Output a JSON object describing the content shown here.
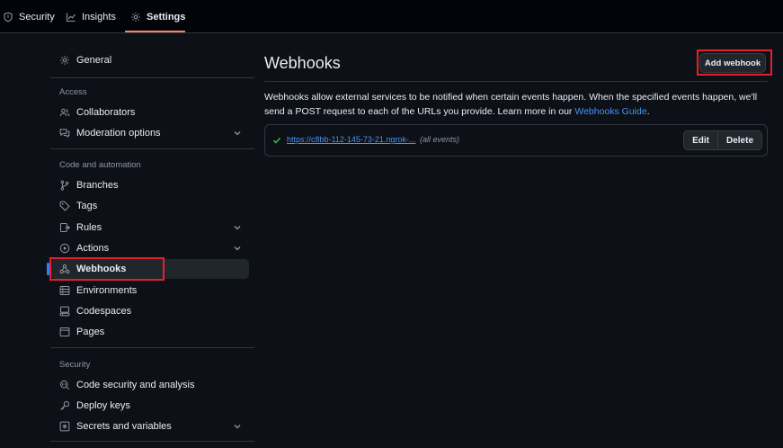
{
  "topnav": {
    "tabs": [
      {
        "label": "Security",
        "icon": "shield-icon"
      },
      {
        "label": "Insights",
        "icon": "graph-icon"
      },
      {
        "label": "Settings",
        "icon": "gear-icon",
        "active": true
      }
    ]
  },
  "sidebar": {
    "general": "General",
    "access_heading": "Access",
    "collaborators": "Collaborators",
    "moderation": "Moderation options",
    "code_heading": "Code and automation",
    "branches": "Branches",
    "tags": "Tags",
    "rules": "Rules",
    "actions": "Actions",
    "webhooks": "Webhooks",
    "environments": "Environments",
    "codespaces": "Codespaces",
    "pages": "Pages",
    "security_heading": "Security",
    "code_security": "Code security and analysis",
    "deploy_keys": "Deploy keys",
    "secrets": "Secrets and variables"
  },
  "main": {
    "title": "Webhooks",
    "add_button": "Add webhook",
    "description_text": "Webhooks allow external services to be notified when certain events happen. When the specified events happen, we'll send a POST request to each of the URLs you provide. Learn more in our ",
    "description_link": "Webhooks Guide",
    "description_end": ".",
    "webhook": {
      "url": "https://c8bb-112-145-73-21.ngrok-...",
      "events": "(all events)",
      "edit": "Edit",
      "delete": "Delete"
    }
  },
  "colors": {
    "background": "#0d1117",
    "topnav_bg": "#010409",
    "accent_underline": "#f78166",
    "link": "#4493f8",
    "success": "#3fb950",
    "highlight_box": "#e5202e"
  }
}
